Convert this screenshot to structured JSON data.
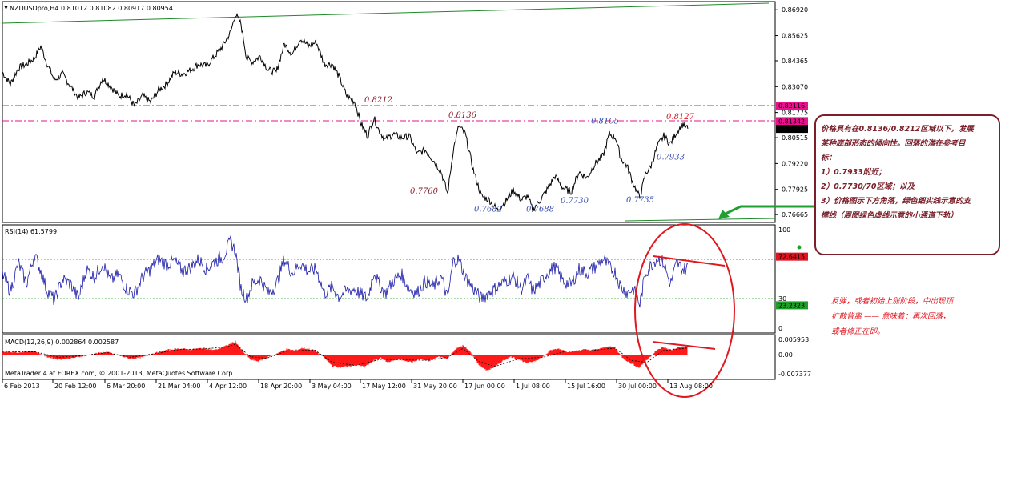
{
  "chart_data": [
    {
      "type": "line",
      "symbol_header": "NZDUSDpro,H4  0.81012 0.81082 0.80917 0.80954",
      "price_ticks": [
        "0.86920",
        "0.85625",
        "0.84365",
        "0.83070",
        "0.81775",
        "0.80515",
        "0.79220",
        "0.77925",
        "0.76665"
      ],
      "price_ticks_values": [
        0.8692,
        0.85625,
        0.84365,
        0.8307,
        0.81775,
        0.80515,
        0.7922,
        0.77925,
        0.76665
      ],
      "ylim": [
        0.7635,
        0.8725
      ],
      "level_tags": [
        {
          "text": "0.82116",
          "value": 0.82116,
          "color": "#e8128c"
        },
        {
          "text": "0.81342",
          "value": 0.81342,
          "color": "#e8128c"
        },
        {
          "text": "0.80954",
          "value": 0.80954,
          "color": "#000000"
        }
      ],
      "horizontal_lines": [
        0.8212,
        0.8136
      ],
      "price_path": [
        [
          0,
          0.838
        ],
        [
          10,
          0.832
        ],
        [
          20,
          0.84
        ],
        [
          30,
          0.842
        ],
        [
          40,
          0.845
        ],
        [
          48,
          0.851
        ],
        [
          55,
          0.843
        ],
        [
          65,
          0.834
        ],
        [
          75,
          0.837
        ],
        [
          85,
          0.831
        ],
        [
          95,
          0.825
        ],
        [
          105,
          0.828
        ],
        [
          115,
          0.826
        ],
        [
          125,
          0.835
        ],
        [
          135,
          0.831
        ],
        [
          145,
          0.826
        ],
        [
          155,
          0.827
        ],
        [
          165,
          0.821
        ],
        [
          175,
          0.826
        ],
        [
          185,
          0.823
        ],
        [
          195,
          0.829
        ],
        [
          205,
          0.832
        ],
        [
          215,
          0.838
        ],
        [
          225,
          0.837
        ],
        [
          235,
          0.839
        ],
        [
          245,
          0.842
        ],
        [
          255,
          0.841
        ],
        [
          265,
          0.846
        ],
        [
          275,
          0.851
        ],
        [
          285,
          0.858
        ],
        [
          291,
          0.867
        ],
        [
          298,
          0.862
        ],
        [
          305,
          0.845
        ],
        [
          312,
          0.843
        ],
        [
          322,
          0.846
        ],
        [
          332,
          0.839
        ],
        [
          342,
          0.838
        ],
        [
          352,
          0.852
        ],
        [
          362,
          0.847
        ],
        [
          372,
          0.855
        ],
        [
          382,
          0.851
        ],
        [
          392,
          0.853
        ],
        [
          402,
          0.842
        ],
        [
          412,
          0.842
        ],
        [
          420,
          0.836
        ],
        [
          430,
          0.826
        ],
        [
          440,
          0.823
        ],
        [
          448,
          0.812
        ],
        [
          456,
          0.806
        ],
        [
          464,
          0.815
        ],
        [
          470,
          0.809
        ],
        [
          478,
          0.804
        ],
        [
          488,
          0.807
        ],
        [
          498,
          0.805
        ],
        [
          508,
          0.806
        ],
        [
          518,
          0.797
        ],
        [
          528,
          0.799
        ],
        [
          538,
          0.794
        ],
        [
          548,
          0.788
        ],
        [
          556,
          0.777
        ],
        [
          563,
          0.799
        ],
        [
          570,
          0.811
        ],
        [
          578,
          0.807
        ],
        [
          588,
          0.789
        ],
        [
          598,
          0.776
        ],
        [
          608,
          0.774
        ],
        [
          618,
          0.769
        ],
        [
          628,
          0.773
        ],
        [
          638,
          0.779
        ],
        [
          648,
          0.774
        ],
        [
          656,
          0.776
        ],
        [
          662,
          0.769
        ],
        [
          670,
          0.773
        ],
        [
          680,
          0.779
        ],
        [
          690,
          0.786
        ],
        [
          700,
          0.78
        ],
        [
          710,
          0.778
        ],
        [
          720,
          0.788
        ],
        [
          730,
          0.785
        ],
        [
          740,
          0.792
        ],
        [
          750,
          0.796
        ],
        [
          758,
          0.807
        ],
        [
          766,
          0.805
        ],
        [
          772,
          0.795
        ],
        [
          780,
          0.791
        ],
        [
          788,
          0.782
        ],
        [
          796,
          0.775
        ],
        [
          803,
          0.787
        ],
        [
          810,
          0.791
        ],
        [
          818,
          0.801
        ],
        [
          826,
          0.806
        ],
        [
          834,
          0.802
        ],
        [
          842,
          0.808
        ],
        [
          850,
          0.812
        ],
        [
          856,
          0.8095
        ]
      ],
      "annotations": [
        {
          "text": "0.8212",
          "value": 0.8212,
          "color": "#8b1c2c"
        },
        {
          "text": "0.8136",
          "value": 0.8136,
          "color": "#8b1c2c"
        },
        {
          "text": "0.8105",
          "value": 0.8105,
          "color": "#3a4fb0"
        },
        {
          "text": "0.8127",
          "value": 0.8127,
          "color": "#e0141e"
        },
        {
          "text": "0.7933",
          "value": 0.7933,
          "color": "#3a4fb0"
        },
        {
          "text": "0.7760",
          "value": 0.776,
          "color": "#8b1c2c"
        },
        {
          "text": "0.7682",
          "value": 0.7682,
          "color": "#3a4fb0"
        },
        {
          "text": "0.7688",
          "value": 0.7688,
          "color": "#3a4fb0"
        },
        {
          "text": "0.7730",
          "value": 0.773,
          "color": "#3a4fb0"
        },
        {
          "text": "0.7735",
          "value": 0.7735,
          "color": "#3a4fb0"
        }
      ],
      "trend_lines": [
        "green channel top line",
        "green support line"
      ]
    },
    {
      "type": "line",
      "title": "RSI(14) 61.5799",
      "ylim": [
        0,
        100
      ],
      "ticks": [
        "100",
        "30",
        "0"
      ],
      "level_tags": [
        {
          "text": "72.6415",
          "value": 72.6415,
          "color": "#e0141e"
        },
        {
          "text": "23.2323",
          "value": 23.2323,
          "color": "#1e9e28"
        }
      ],
      "rsi_path": [
        [
          0,
          55
        ],
        [
          10,
          38
        ],
        [
          20,
          66
        ],
        [
          30,
          45
        ],
        [
          40,
          75
        ],
        [
          48,
          58
        ],
        [
          55,
          40
        ],
        [
          65,
          28
        ],
        [
          75,
          50
        ],
        [
          85,
          45
        ],
        [
          95,
          30
        ],
        [
          105,
          60
        ],
        [
          115,
          52
        ],
        [
          125,
          66
        ],
        [
          135,
          48
        ],
        [
          145,
          55
        ],
        [
          155,
          40
        ],
        [
          165,
          35
        ],
        [
          175,
          52
        ],
        [
          185,
          60
        ],
        [
          195,
          70
        ],
        [
          205,
          65
        ],
        [
          215,
          68
        ],
        [
          225,
          58
        ],
        [
          235,
          62
        ],
        [
          245,
          70
        ],
        [
          255,
          60
        ],
        [
          265,
          68
        ],
        [
          275,
          72
        ],
        [
          285,
          88
        ],
        [
          291,
          78
        ],
        [
          298,
          40
        ],
        [
          305,
          30
        ],
        [
          312,
          45
        ],
        [
          322,
          50
        ],
        [
          332,
          35
        ],
        [
          342,
          44
        ],
        [
          352,
          70
        ],
        [
          362,
          56
        ],
        [
          372,
          66
        ],
        [
          382,
          58
        ],
        [
          392,
          60
        ],
        [
          402,
          35
        ],
        [
          412,
          42
        ],
        [
          420,
          32
        ],
        [
          430,
          38
        ],
        [
          440,
          40
        ],
        [
          448,
          34
        ],
        [
          456,
          30
        ],
        [
          464,
          58
        ],
        [
          470,
          45
        ],
        [
          478,
          35
        ],
        [
          488,
          48
        ],
        [
          498,
          55
        ],
        [
          508,
          40
        ],
        [
          518,
          36
        ],
        [
          528,
          48
        ],
        [
          538,
          42
        ],
        [
          548,
          52
        ],
        [
          556,
          30
        ],
        [
          563,
          68
        ],
        [
          570,
          70
        ],
        [
          578,
          52
        ],
        [
          588,
          40
        ],
        [
          598,
          30
        ],
        [
          608,
          36
        ],
        [
          618,
          42
        ],
        [
          628,
          48
        ],
        [
          638,
          52
        ],
        [
          648,
          40
        ],
        [
          656,
          50
        ],
        [
          662,
          38
        ],
        [
          670,
          44
        ],
        [
          680,
          56
        ],
        [
          690,
          62
        ],
        [
          700,
          48
        ],
        [
          710,
          44
        ],
        [
          720,
          60
        ],
        [
          730,
          56
        ],
        [
          740,
          62
        ],
        [
          750,
          70
        ],
        [
          758,
          62
        ],
        [
          766,
          56
        ],
        [
          772,
          42
        ],
        [
          780,
          36
        ],
        [
          788,
          40
        ],
        [
          796,
          24
        ],
        [
          803,
          56
        ],
        [
          810,
          64
        ],
        [
          818,
          72
        ],
        [
          826,
          66
        ],
        [
          834,
          44
        ],
        [
          842,
          66
        ],
        [
          850,
          60
        ],
        [
          856,
          61.6
        ]
      ]
    },
    {
      "type": "bar",
      "title": "MACD(12,26,9) 0.002864 0.002587",
      "ylim": [
        -0.009,
        0.0072
      ],
      "ticks": [
        "0.005953",
        "0.00",
        "-0.007377"
      ],
      "macd_histogram": [
        [
          0,
          0.0012
        ],
        [
          20,
          0.001
        ],
        [
          40,
          0.0015
        ],
        [
          55,
          -0.0008
        ],
        [
          70,
          -0.0018
        ],
        [
          85,
          -0.0015
        ],
        [
          100,
          -0.0006
        ],
        [
          115,
          0.0004
        ],
        [
          130,
          0.0011
        ],
        [
          145,
          -0.0003
        ],
        [
          160,
          -0.0016
        ],
        [
          175,
          -0.001
        ],
        [
          190,
          0.0006
        ],
        [
          205,
          0.0018
        ],
        [
          220,
          0.0024
        ],
        [
          235,
          0.002
        ],
        [
          250,
          0.0026
        ],
        [
          265,
          0.0018
        ],
        [
          280,
          0.0035
        ],
        [
          291,
          0.0052
        ],
        [
          300,
          0.0014
        ],
        [
          310,
          -0.002
        ],
        [
          320,
          -0.0026
        ],
        [
          330,
          -0.0012
        ],
        [
          345,
          0.0008
        ],
        [
          355,
          0.0022
        ],
        [
          365,
          0.0016
        ],
        [
          375,
          0.0026
        ],
        [
          390,
          0.0018
        ],
        [
          402,
          -0.0012
        ],
        [
          412,
          -0.0044
        ],
        [
          422,
          -0.005
        ],
        [
          432,
          -0.0044
        ],
        [
          442,
          -0.004
        ],
        [
          452,
          -0.0048
        ],
        [
          462,
          -0.0026
        ],
        [
          472,
          -0.0012
        ],
        [
          482,
          -0.003
        ],
        [
          492,
          -0.0018
        ],
        [
          502,
          -0.0022
        ],
        [
          512,
          -0.003
        ],
        [
          522,
          -0.0016
        ],
        [
          532,
          -0.0026
        ],
        [
          545,
          -0.0008
        ],
        [
          556,
          -0.0016
        ],
        [
          565,
          0.002
        ],
        [
          575,
          0.0036
        ],
        [
          585,
          0.001
        ],
        [
          595,
          -0.004
        ],
        [
          605,
          -0.0062
        ],
        [
          615,
          -0.0048
        ],
        [
          625,
          -0.0024
        ],
        [
          635,
          -0.0008
        ],
        [
          645,
          -0.0018
        ],
        [
          655,
          -0.0034
        ],
        [
          665,
          -0.0024
        ],
        [
          675,
          -0.0008
        ],
        [
          685,
          0.0018
        ],
        [
          695,
          0.0024
        ],
        [
          705,
          0.0012
        ],
        [
          715,
          0.0014
        ],
        [
          725,
          0.002
        ],
        [
          735,
          0.0018
        ],
        [
          745,
          0.0022
        ],
        [
          755,
          0.0032
        ],
        [
          765,
          0.0028
        ],
        [
          775,
          -0.0014
        ],
        [
          785,
          -0.0034
        ],
        [
          795,
          -0.005
        ],
        [
          805,
          -0.002
        ],
        [
          815,
          0.0012
        ],
        [
          825,
          0.003
        ],
        [
          835,
          0.0018
        ],
        [
          845,
          0.003
        ],
        [
          855,
          0.0029
        ]
      ],
      "signal_path": [
        [
          0,
          0.001
        ],
        [
          40,
          0.0012
        ],
        [
          70,
          -0.001
        ],
        [
          100,
          -0.0004
        ],
        [
          130,
          0.0008
        ],
        [
          160,
          -0.001
        ],
        [
          190,
          0.0004
        ],
        [
          220,
          0.002
        ],
        [
          250,
          0.0022
        ],
        [
          280,
          0.003
        ],
        [
          291,
          0.004
        ],
        [
          310,
          -0.0008
        ],
        [
          330,
          -0.0014
        ],
        [
          355,
          0.0014
        ],
        [
          390,
          0.0018
        ],
        [
          412,
          -0.003
        ],
        [
          442,
          -0.0042
        ],
        [
          472,
          -0.0018
        ],
        [
          502,
          -0.002
        ],
        [
          532,
          -0.0022
        ],
        [
          556,
          -0.001
        ],
        [
          575,
          0.0024
        ],
        [
          595,
          -0.0026
        ],
        [
          615,
          -0.0046
        ],
        [
          645,
          -0.0016
        ],
        [
          675,
          -0.001
        ],
        [
          705,
          0.0014
        ],
        [
          735,
          0.0016
        ],
        [
          765,
          0.0026
        ],
        [
          785,
          -0.0022
        ],
        [
          805,
          -0.003
        ],
        [
          825,
          0.0016
        ],
        [
          855,
          0.0026
        ]
      ],
      "footer_text": "MetaTrader 4 at FOREX.com, © 2001-2013, MetaQuotes Software Corp."
    }
  ],
  "x_axis_labels": [
    "6 Feb 2013",
    "20 Feb 12:00",
    "6 Mar 20:00",
    "21 Mar 04:00",
    "4 Apr 12:00",
    "18 Apr 20:00",
    "3 May 04:00",
    "17 May 12:00",
    "31 May 20:00",
    "17 Jun 00:00",
    "1 Jul 08:00",
    "15 Jul 16:00",
    "30 Jul 00:00",
    "13 Aug 08:00"
  ],
  "callout": {
    "lines": [
      "价格具有在0.8136/0.8212区域以下，发展",
      "某种底部形态的倾向性。回落的潜在参考目",
      "标：",
      "1）0.7933附近；",
      "2）0.7730/70区域；以及",
      "3）价格图示下方角落，绿色细实线示意的支",
      "撑线（周图绿色虚线示意的小通道下轨）"
    ]
  },
  "note": {
    "lines": [
      "反弹，或者初始上涨阶段，中出现顶",
      "扩散背离 —— 意味着：再次回落，",
      "或者修正在即。"
    ]
  },
  "colors": {
    "price": "#000000",
    "rsi": "#1a1aa8",
    "macd_hist": "#ff1a1a",
    "trend_green": "#1e8a28",
    "arrow_green": "#20a030",
    "divergence_red": "#e01820",
    "level_pink": "#e8128c"
  }
}
